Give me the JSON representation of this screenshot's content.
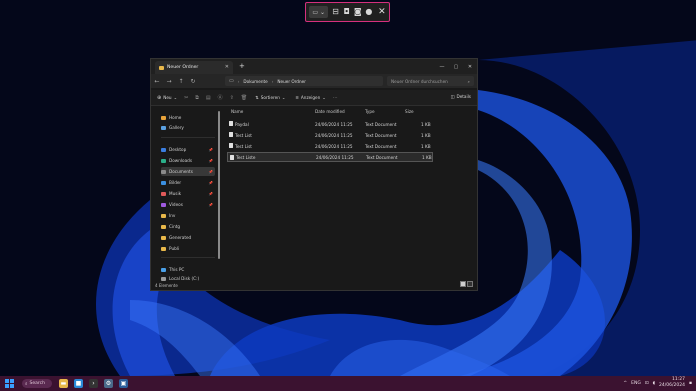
{
  "snip_toolbar": {
    "mode_glyph": "▭ ⌄",
    "buttons": [
      "rectangle-icon",
      "window-icon",
      "fullscreen-icon",
      "freeform-icon"
    ],
    "close": "✕"
  },
  "explorer": {
    "tab_title": "Neuer Ordner",
    "nav": [
      "←",
      "→",
      "↑",
      "↻"
    ],
    "breadcrumb": [
      "Dokumente",
      "Neuer Ordner"
    ],
    "search_placeholder": "Neuer Ordner durchsuchen",
    "commands": {
      "new": "Neu",
      "sort": "Sortieren",
      "view": "Anzeigen",
      "details": "Details"
    },
    "sidebar": {
      "top": [
        {
          "label": "Home",
          "icon": "home-icon",
          "color": "#e8a33a"
        },
        {
          "label": "Gallery",
          "icon": "gallery-icon",
          "color": "#5aa0e0"
        }
      ],
      "quick": [
        {
          "label": "Desktop",
          "icon": "desktop-icon",
          "color": "#3a7ee0",
          "pinned": true
        },
        {
          "label": "Downloads",
          "icon": "downloads-icon",
          "color": "#2bb08a",
          "pinned": true
        },
        {
          "label": "Documents",
          "icon": "documents-icon",
          "color": "#8a8a8a",
          "pinned": true,
          "selected": true
        },
        {
          "label": "Bilder",
          "icon": "pictures-icon",
          "color": "#3b8fe0",
          "pinned": true
        },
        {
          "label": "Musik",
          "icon": "music-icon",
          "color": "#e05a5a",
          "pinned": true
        },
        {
          "label": "Videos",
          "icon": "videos-icon",
          "color": "#a05ae0",
          "pinned": true
        },
        {
          "label": "Inv",
          "icon": "folder-icon",
          "color": "#e8b84a"
        },
        {
          "label": "Cintg",
          "icon": "folder-icon",
          "color": "#e8b84a"
        },
        {
          "label": "Generated",
          "icon": "folder-icon",
          "color": "#e8b84a"
        },
        {
          "label": "Publi",
          "icon": "folder-icon",
          "color": "#e8b84a"
        }
      ],
      "bottom": [
        {
          "label": "This PC",
          "icon": "pc-icon",
          "color": "#4aa0e8"
        },
        {
          "label": "Local Disk (C:)",
          "icon": "disk-icon",
          "color": "#9a9a9a"
        }
      ]
    },
    "columns": [
      "Name",
      "Date modified",
      "Type",
      "Size"
    ],
    "files": [
      {
        "name": "Paydal",
        "date": "24/06/2024 11:25",
        "type": "Text Document",
        "size": "1 KB",
        "selected": false
      },
      {
        "name": "Test List",
        "date": "24/06/2024 11:25",
        "type": "Text Document",
        "size": "1 KB",
        "selected": false
      },
      {
        "name": "Test List",
        "date": "24/06/2024 11:25",
        "type": "Text Document",
        "size": "1 KB",
        "selected": false
      },
      {
        "name": "Test Liste",
        "date": "24/06/2024 11:25",
        "type": "Text Document",
        "size": "1 KB",
        "selected": true
      }
    ],
    "status": "4 Elemente"
  },
  "taskbar": {
    "search_label": "Search",
    "apps": [
      {
        "name": "explorer-app-icon",
        "color": "#e8b84a",
        "glyph": "▬"
      },
      {
        "name": "store-app-icon",
        "color": "#2a8ad8",
        "glyph": "■"
      },
      {
        "name": "terminal-app-icon",
        "color": "#333",
        "glyph": "›"
      },
      {
        "name": "settings-app-icon",
        "color": "#4a6a8a",
        "glyph": "⚙"
      },
      {
        "name": "photos-app-icon",
        "color": "#2b5d9a",
        "glyph": "▣"
      }
    ],
    "tray": {
      "chevron": "^",
      "lang": "ENG",
      "time": "11:27",
      "date": "24/06/2024"
    }
  }
}
